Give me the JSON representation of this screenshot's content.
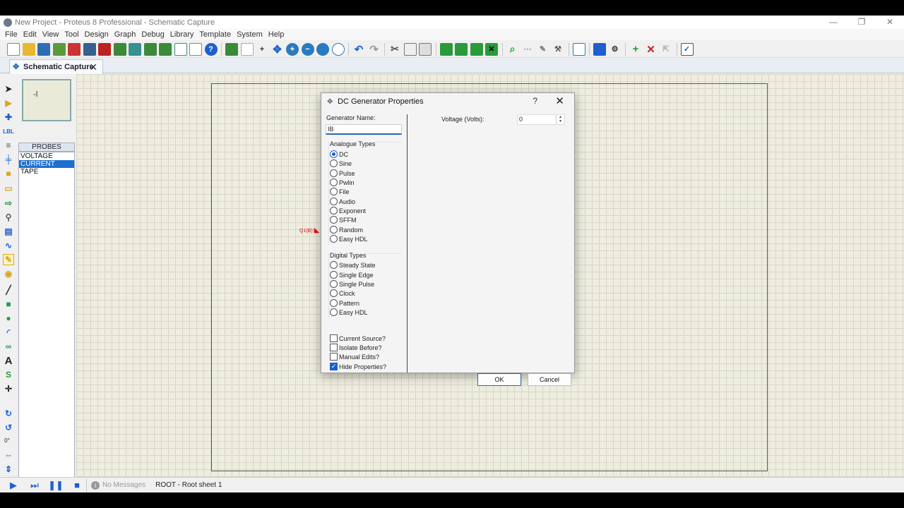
{
  "window": {
    "title": "New Project - Proteus 8 Professional - Schematic Capture",
    "min": "—",
    "max": "❐",
    "close": "✕"
  },
  "menu": [
    "File",
    "Edit",
    "View",
    "Tool",
    "Design",
    "Graph",
    "Debug",
    "Library",
    "Template",
    "System",
    "Help"
  ],
  "tab": {
    "label": "Schematic Capture",
    "close": "✕"
  },
  "probes": {
    "header": "PROBES",
    "items": [
      "VOLTAGE",
      "CURRENT",
      "TAPE"
    ],
    "selected": "CURRENT"
  },
  "canvas": {
    "component_label": "Q1(B)"
  },
  "rotation": "0°",
  "status": {
    "messages": "No Messages",
    "sheet": "ROOT - Root sheet 1"
  },
  "dialog": {
    "title": "DC Generator Properties",
    "help": "?",
    "close": "✕",
    "generator_name_label": "Generator Name:",
    "generator_name": "IB",
    "analogue_label": "Analogue Types",
    "analogue": [
      "DC",
      "Sine",
      "Pulse",
      "Pwlin",
      "File",
      "Audio",
      "Exponent",
      "SFFM",
      "Random",
      "Easy HDL"
    ],
    "analogue_selected": "DC",
    "digital_label": "Digital Types",
    "digital": [
      "Steady State",
      "Single Edge",
      "Single Pulse",
      "Clock",
      "Pattern",
      "Easy HDL"
    ],
    "checks": [
      {
        "label": "Current Source?",
        "checked": false
      },
      {
        "label": "Isolate Before?",
        "checked": false
      },
      {
        "label": "Manual Edits?",
        "checked": false
      },
      {
        "label": "Hide Properties?",
        "checked": true
      }
    ],
    "voltage_label": "Voltage (Volts):",
    "voltage_value": "0",
    "ok": "OK",
    "cancel": "Cancel"
  },
  "colors": {
    "accent": "#1e5fd0",
    "canvas": "#eeede0",
    "component": "#d11111"
  }
}
